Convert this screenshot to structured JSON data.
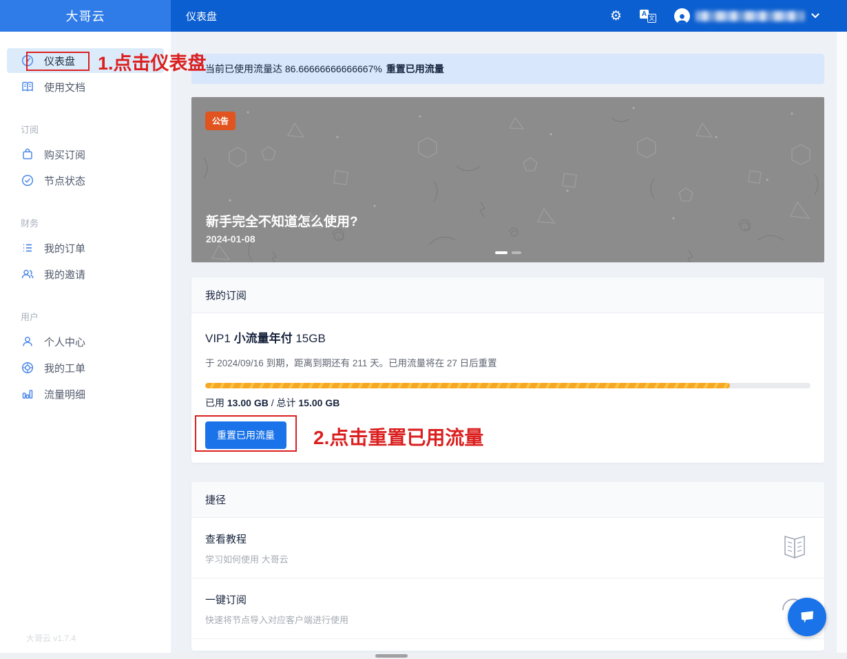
{
  "header": {
    "logo": "大哥云",
    "page_title": "仪表盘",
    "language_icon_letter_a": "A",
    "language_icon_letter_wen": "文"
  },
  "sidebar": {
    "sections": [
      {
        "label": "",
        "items": [
          {
            "label": "仪表盘",
            "active": true
          },
          {
            "label": "使用文档"
          }
        ]
      },
      {
        "label": "订阅",
        "items": [
          {
            "label": "购买订阅"
          },
          {
            "label": "节点状态"
          }
        ]
      },
      {
        "label": "财务",
        "items": [
          {
            "label": "我的订单"
          },
          {
            "label": "我的邀请"
          }
        ]
      },
      {
        "label": "用户",
        "items": [
          {
            "label": "个人中心"
          },
          {
            "label": "我的工单"
          },
          {
            "label": "流量明细"
          }
        ]
      }
    ],
    "version": "大哥云 v1.7.4"
  },
  "alert": {
    "text": "当前已使用流量达 86.66666666666667%",
    "link": "重置已用流量"
  },
  "announcement": {
    "badge": "公告",
    "title": "新手完全不知道怎么使用?",
    "date": "2024-01-08",
    "pagination": {
      "total_dots": 2,
      "active_index": 0
    }
  },
  "subscription": {
    "card_title": "我的订阅",
    "plan_prefix": "VIP1",
    "plan_name": "小流量年付",
    "plan_size": "15GB",
    "expiry_text": "于 2024/09/16 到期，距离到期还有 211 天。已用流量将在 27 日后重置",
    "usage_percent": 86.66666666666667,
    "progress_style": "width:86.66666666666667%",
    "used_prefix": "已用",
    "used_value": "13.00 GB",
    "total_prefix": "/ 总计",
    "total_value": "15.00 GB",
    "reset_button": "重置已用流量"
  },
  "shortcuts": {
    "card_title": "捷径",
    "items": [
      {
        "title": "查看教程",
        "subtitle": "学习如何使用 大哥云",
        "icon": "book-icon"
      },
      {
        "title": "一键订阅",
        "subtitle": "快速将节点导入对应客户端进行使用",
        "icon": "subscribe-import-icon"
      }
    ]
  },
  "annotations": {
    "step1": "1.点击仪表盘",
    "step2": "2.点击重置已用流量"
  },
  "colors": {
    "header_bg": "#0c5fd0",
    "logo_bg": "#2f7ce8",
    "active_item_bg": "#dcebfa",
    "alert_bg": "#d8e7fb",
    "banner_bg": "#8c8c8c",
    "badge_bg": "#e2541f",
    "progress_orange": "#f7a823",
    "button_blue": "#1a73e8",
    "annotation_red": "#db1f1f"
  }
}
